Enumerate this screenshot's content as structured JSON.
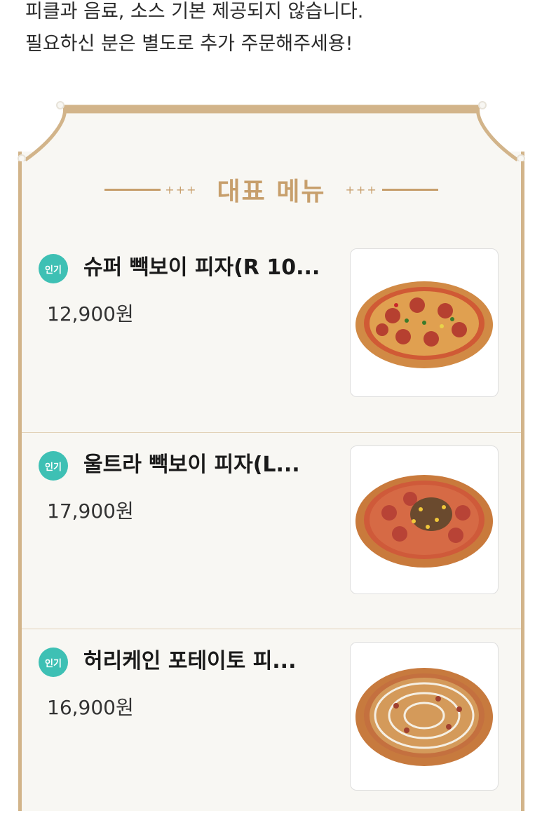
{
  "notice": {
    "line1": "피클과 음료, 소스 기본 제공되지 않습니다.",
    "line2": "필요하신 분은 별도로 추가 주문해주세용!"
  },
  "section": {
    "title": "대표 메뉴",
    "ornament_left": "+++",
    "ornament_right": "+++"
  },
  "colors": {
    "accent": "#c79f6c",
    "badge": "#3ec0b4"
  },
  "menu": {
    "items": [
      {
        "badge": "인기",
        "name": "슈퍼 빽보이 피자(R 10...",
        "price": "12,900원",
        "image": "super-pizza-image"
      },
      {
        "badge": "인기",
        "name": "울트라 빽보이 피자(L...",
        "price": "17,900원",
        "image": "ultra-pizza-image"
      },
      {
        "badge": "인기",
        "name": "허리케인 포테이토 피...",
        "price": "16,900원",
        "image": "potato-pizza-image"
      }
    ]
  }
}
